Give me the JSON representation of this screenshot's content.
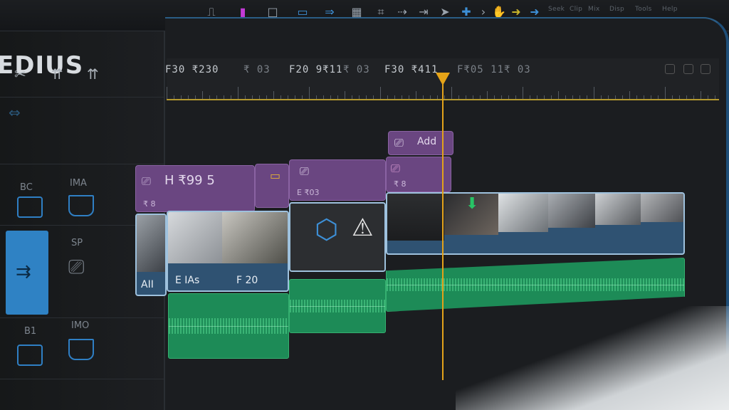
{
  "app": {
    "logo": "EDIUS"
  },
  "toolbar": {
    "icons": [
      "mode-icon",
      "magenta-marker-icon",
      "square-icon",
      "blue-square-icon",
      "arrow-right-icon",
      "grid-icon",
      "crop-icon",
      "forward-arrow-icon",
      "skip-arrow-icon",
      "cursor-icon",
      "plus-icon",
      "chevron-right-icon",
      "hand-icon",
      "yellow-arrow-icon",
      "blue-arrow-icon"
    ],
    "menu": [
      "Seek",
      "Clip",
      "Mix",
      "Disp",
      "Tools",
      "Help"
    ]
  },
  "left_panel": {
    "tools": [
      "✂",
      "⇈",
      "⇈"
    ],
    "tracks": [
      {
        "label": "BC"
      },
      {
        "label": "IMA"
      },
      {
        "label": "SP"
      },
      {
        "label": "B1"
      },
      {
        "label": "IMO"
      }
    ]
  },
  "ruler": {
    "timecodes": [
      "F30 ₹230",
      "₹ 03",
      "F20 9₹11",
      "₹ 03",
      "F30 ₹411",
      "F₹05 11",
      "₹ 03"
    ]
  },
  "clips": {
    "title_upper": {
      "caption": "Add"
    },
    "title_row": [
      {
        "caption": "𝖧 ₹99 5",
        "sub": "₹ 8"
      },
      {
        "caption": "⎚",
        "sub": ""
      },
      {
        "caption": "⎚",
        "sub": "E ₹03"
      },
      {
        "caption": "⎚",
        "sub": "₹ 8"
      }
    ],
    "video": [
      {
        "label": "AII"
      },
      {
        "label": "E IAs"
      },
      {
        "label": "F 20"
      }
    ]
  },
  "colors": {
    "accent": "#2f82c4",
    "playhead": "#e3a21a",
    "title_clip": "#6a4681",
    "audio_clip": "#1d8b57",
    "video_clip": "#2f5272"
  }
}
